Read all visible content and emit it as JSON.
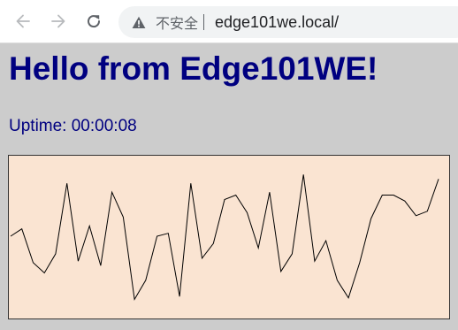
{
  "browser": {
    "security_label": "不安全",
    "url": "edge101we.local/",
    "icons": {
      "back": "arrow-left-icon",
      "forward": "arrow-right-icon",
      "reload": "reload-icon",
      "security": "warning-triangle-icon"
    }
  },
  "page": {
    "title": "Hello from Edge101WE!",
    "uptime": "Uptime: 00:00:08"
  },
  "colors": {
    "page_background": "#cccccc",
    "heading": "#000080",
    "chart_background": "#fae4d2",
    "chart_line": "#000000"
  },
  "chart_data": {
    "type": "line",
    "y_range": [
      0,
      100
    ],
    "values": [
      50,
      55,
      32,
      25,
      38,
      86,
      33,
      57,
      30,
      80,
      63,
      7,
      20,
      50,
      52,
      9,
      86,
      35,
      45,
      75,
      78,
      66,
      42,
      80,
      26,
      38,
      92,
      33,
      47,
      20,
      8,
      32,
      62,
      78,
      78,
      74,
      64,
      67,
      89
    ]
  }
}
